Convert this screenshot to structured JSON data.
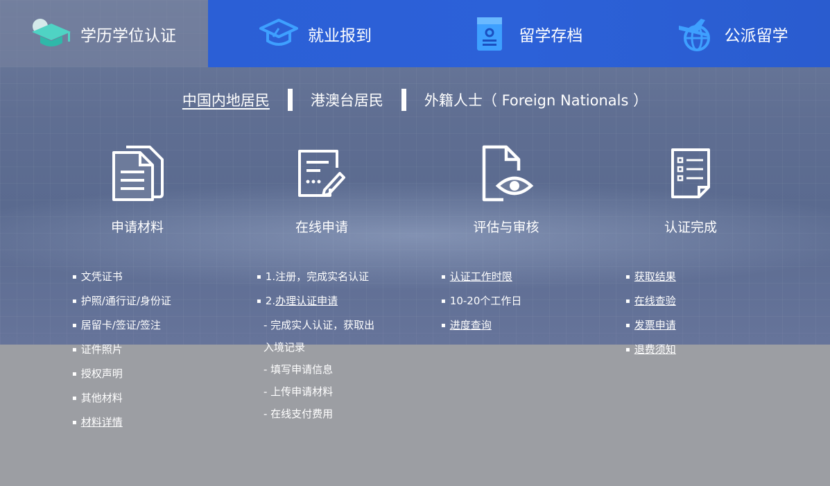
{
  "tabs": [
    {
      "label": "学历学位认证",
      "icon": "graduation-cap-icon",
      "active": true
    },
    {
      "label": "就业报到",
      "icon": "graduation-cap-outline-icon"
    },
    {
      "label": "留学存档",
      "icon": "archive-file-icon"
    },
    {
      "label": "公派留学",
      "icon": "airplane-globe-icon"
    }
  ],
  "residence": {
    "options": [
      "中国内地居民",
      "港澳台居民",
      "外籍人士（ Foreign Nationals ）"
    ],
    "selected": "中国内地居民"
  },
  "steps": [
    {
      "title": "申请材料",
      "icon": "documents-icon"
    },
    {
      "title": "在线申请",
      "icon": "form-edit-icon"
    },
    {
      "title": "评估与审核",
      "icon": "document-eye-icon"
    },
    {
      "title": "认证完成",
      "icon": "checklist-icon"
    }
  ],
  "columns": {
    "materials": [
      "文凭证书",
      "护照/通行证/身份证",
      "居留卡/签证/签注",
      "证件照片",
      "授权声明",
      "其他材料",
      "材料详情"
    ],
    "online": {
      "step1": "1.注册，完成实名认证",
      "step2_prefix": "2.",
      "step2_link": "办理认证申请",
      "subs": [
        "- 完成实人认证，获取出",
        "入境记录",
        "- 填写申请信息",
        "- 上传申请材料",
        "- 在线支付费用"
      ]
    },
    "review": {
      "link1": "认证工作时限",
      "text": "10-20个工作日",
      "link2": "进度查询"
    },
    "done": [
      "获取结果",
      "在线查验",
      "发票申请",
      "退费须知"
    ]
  },
  "colors": {
    "tab_blue": "#2b5fd6",
    "accent_teal": "#4fd3c4"
  }
}
